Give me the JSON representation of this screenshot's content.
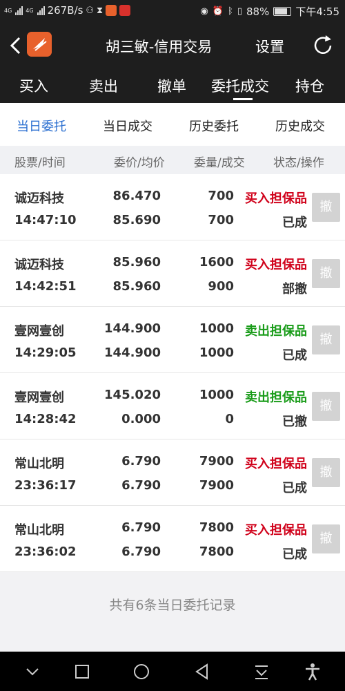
{
  "status_bar": {
    "signal1_label": "4G",
    "signal2_label": "4G",
    "speed": "267B/s",
    "battery": "88%",
    "time": "下午4:55"
  },
  "header": {
    "title": "胡三敏-信用交易",
    "settings_label": "设置"
  },
  "tabs": [
    "买入",
    "卖出",
    "撤单",
    "委托成交",
    "持仓"
  ],
  "active_tab": "委托成交",
  "subtabs": [
    "当日委托",
    "当日成交",
    "历史委托",
    "历史成交"
  ],
  "active_subtab": "当日委托",
  "columns": [
    "股票/时间",
    "委价/均价",
    "委量/成交",
    "状态/操作"
  ],
  "orders": [
    {
      "name": "诚迈科技",
      "time": "14:47:10",
      "price": "86.470",
      "avg": "85.690",
      "qty": "700",
      "done": "700",
      "type": "买入担保品",
      "state": "已成",
      "action": "撤"
    },
    {
      "name": "诚迈科技",
      "time": "14:42:51",
      "price": "85.960",
      "avg": "85.960",
      "qty": "1600",
      "done": "900",
      "type": "买入担保品",
      "state": "部撤",
      "action": "撤"
    },
    {
      "name": "壹网壹创",
      "time": "14:29:05",
      "price": "144.900",
      "avg": "144.900",
      "qty": "1000",
      "done": "1000",
      "type": "卖出担保品",
      "state": "已成",
      "action": "撤"
    },
    {
      "name": "壹网壹创",
      "time": "14:28:42",
      "price": "145.020",
      "avg": "0.000",
      "qty": "1000",
      "done": "0",
      "type": "卖出担保品",
      "state": "已撤",
      "action": "撤"
    },
    {
      "name": "常山北明",
      "time": "23:36:17",
      "price": "6.790",
      "avg": "6.790",
      "qty": "7900",
      "done": "7900",
      "type": "买入担保品",
      "state": "已成",
      "action": "撤"
    },
    {
      "name": "常山北明",
      "time": "23:36:02",
      "price": "6.790",
      "avg": "6.790",
      "qty": "7800",
      "done": "7800",
      "type": "买入担保品",
      "state": "已成",
      "action": "撤"
    }
  ],
  "footer_text": "共有6条当日委托记录",
  "colors": {
    "buy": "#d0021b",
    "sell": "#1a9c1a",
    "active_subtab": "#2b6fd0",
    "header_bg": "#1e1e1e"
  },
  "icons": [
    "back-icon",
    "app-logo-icon",
    "refresh-icon",
    "nav-down-icon",
    "nav-recent-icon",
    "nav-home-icon",
    "nav-back-icon",
    "nav-download-icon",
    "nav-accessibility-icon"
  ]
}
